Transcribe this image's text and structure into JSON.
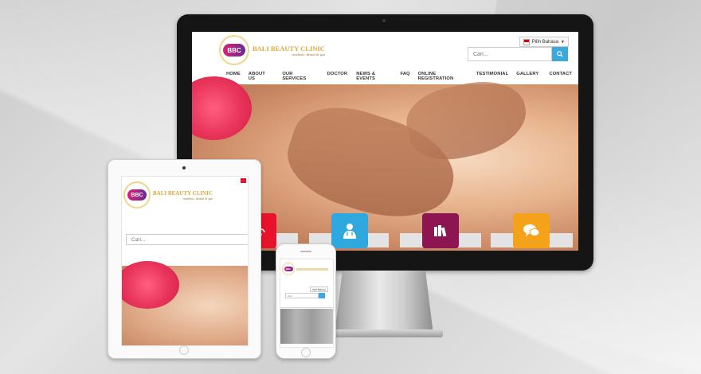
{
  "site": {
    "logo_mark": "BBC",
    "name": "BALI BEAUTY CLINIC",
    "tagline": "aesthetic, dental & spa",
    "language_label": "Pilih Bahasa",
    "search_placeholder": "Cari...",
    "nav": [
      "HOME",
      "ABOUT US",
      "OUR SERVICES",
      "DOCTOR",
      "NEWS & EVENTS",
      "FAQ",
      "ONLINE REGISTRATION",
      "TESTIMONIAL",
      "GALLERY",
      "CONTACT"
    ]
  },
  "service_tiles": [
    {
      "icon": "lotus-icon",
      "color": "#e8132a"
    },
    {
      "icon": "doctor-icon",
      "color": "#2fa8e0"
    },
    {
      "icon": "books-icon",
      "color": "#8c1552"
    },
    {
      "icon": "chat-bubbles-icon",
      "color": "#f5a21b"
    }
  ],
  "colors": {
    "accent_blue": "#3ca9dc",
    "logo_gold": "#d9a93a",
    "logo_pink": "#d9217a",
    "logo_purple": "#6b2a8e"
  }
}
